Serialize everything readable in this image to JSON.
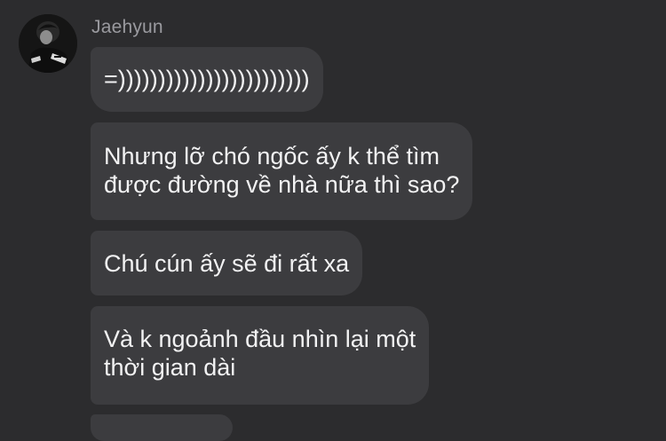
{
  "conversation": {
    "sender_name": "Jaehyun",
    "avatar_icon": "profile-photo-avatar",
    "messages": [
      {
        "text": "=))))))))))))))))))))))))"
      },
      {
        "text": "Nhưng lỡ chó ngốc ấy k thể tìm\nđược đường về nhà nữa thì sao?"
      },
      {
        "text": "Chú cún ấy sẽ đi rất xa"
      },
      {
        "text": "Và k ngoảnh đầu nhìn lại một\nthời gian dài"
      }
    ]
  },
  "colors": {
    "background": "#2c2c2e",
    "bubble": "#3c3c3f",
    "message_text": "#f2f2f3",
    "sender_name": "#9a9a9f"
  }
}
